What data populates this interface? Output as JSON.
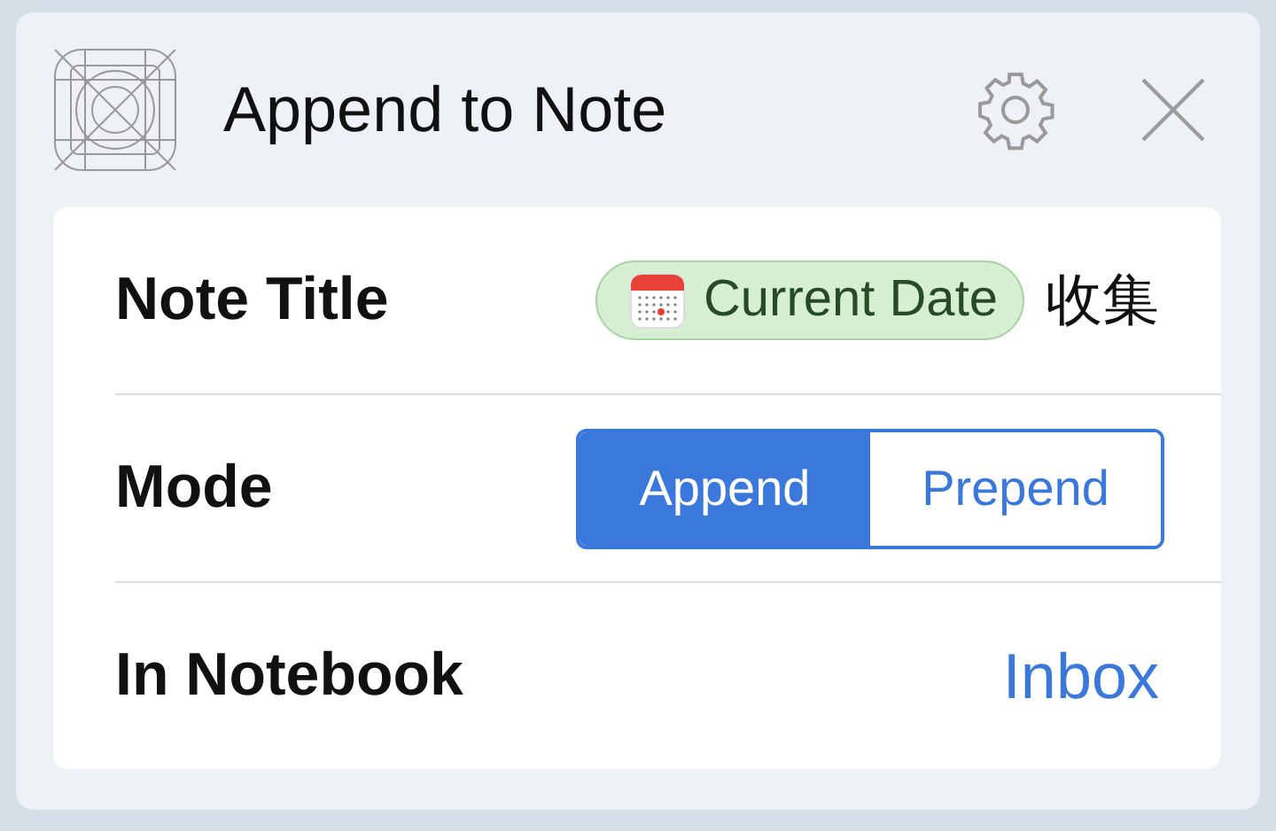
{
  "header": {
    "title": "Append to Note"
  },
  "rows": [
    {
      "kind": "token",
      "label": "Note Title",
      "token": "Current Date",
      "text": "收集"
    },
    {
      "kind": "segmented",
      "label": "Mode",
      "options": [
        {
          "label": "Append",
          "selected": true
        },
        {
          "label": "Prepend",
          "selected": false
        }
      ]
    },
    {
      "kind": "link",
      "label": "In Notebook",
      "value": "Inbox"
    }
  ]
}
